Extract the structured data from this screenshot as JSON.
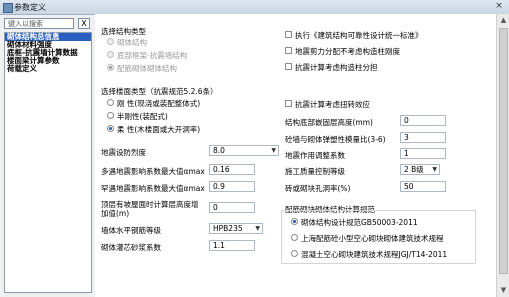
{
  "window": {
    "title": "参数定义",
    "close": "×"
  },
  "sidebar": {
    "search_placeholder": "键入以搜索",
    "clear": "X",
    "items": [
      {
        "label": "砌体结构总信息",
        "selected": true
      },
      {
        "label": "砌体材料强度",
        "selected": false
      },
      {
        "label": "底框-抗震墙计算数据",
        "selected": false
      },
      {
        "label": "楼面梁计算参数",
        "selected": false
      },
      {
        "label": "荷载定义",
        "selected": false
      }
    ]
  },
  "structure_type": {
    "title": "选择结构类型",
    "options": [
      {
        "label": "砌体结构",
        "checked": false,
        "enabled": false
      },
      {
        "label": "底部框架-抗震墙结构",
        "checked": false,
        "enabled": false
      },
      {
        "label": "配筋砌体砌体结构",
        "checked": true,
        "enabled": false
      }
    ]
  },
  "floor_type": {
    "title": "选择楼面类型（抗震规范5.2.6条）",
    "options": [
      {
        "label": "刚  性(现浇或装配整体式)",
        "checked": false
      },
      {
        "label": "半刚性(装配式)",
        "checked": false
      },
      {
        "label": "柔  性(木楼面或大开洞率)",
        "checked": true
      }
    ]
  },
  "right_checks": [
    {
      "label": "执行《建筑结构可靠性设计统一标准》",
      "checked": false
    },
    {
      "label": "地震剪力分配不考虑构造柱刚度",
      "checked": false
    },
    {
      "label": "抗震计算考虑构造柱分担",
      "checked": false
    },
    {
      "label": "抗震计算考虑扭转效应",
      "checked": false
    }
  ],
  "left_fields": {
    "intensity": {
      "label": "地震设防烈度",
      "value": "8.0"
    },
    "alpha_max_frequent": {
      "label": "多遇地震影响系数最大值αmax",
      "value": "0.16"
    },
    "alpha_max_rare": {
      "label": "罕遇地震影响系数最大值αmax",
      "value": "0.9"
    },
    "roof_height": {
      "label": "顶层有坡屋面时计算层高度增加值(m)",
      "value": "0"
    },
    "steel_grade": {
      "label": "墙体水平钢筋等级",
      "value": "HPB235"
    },
    "grout_factor": {
      "label": "砌体灌芯砂浆系数",
      "value": "1.1"
    }
  },
  "right_fields": {
    "embed_depth": {
      "label": "结构底部嵌固层高度(mm)",
      "value": "0"
    },
    "axial_ratio": {
      "label": "砼墙与砌体弹塑性模量比(3-6)",
      "value": "3"
    },
    "seismic_factor": {
      "label": "地震作用调整系数",
      "value": "1"
    },
    "quality_grade": {
      "label": "施工质量控制等级",
      "value": "2 B级"
    },
    "hole_ratio": {
      "label": "砖或砌块孔洞率(%)",
      "value": "50"
    }
  },
  "code_group": {
    "title": "配筋砌块砌体结构计算规范",
    "options": [
      {
        "label": "砌体结构设计规范GB50003-2011",
        "checked": true
      },
      {
        "label": "上海配筋砼小型空心砌块砌体建筑技术规程",
        "checked": false
      },
      {
        "label": "混凝土空心砌块建筑技术规程JGJ/T14-2011",
        "checked": false
      }
    ]
  },
  "scrollbar": {
    "up": "▲",
    "down": "▼"
  }
}
